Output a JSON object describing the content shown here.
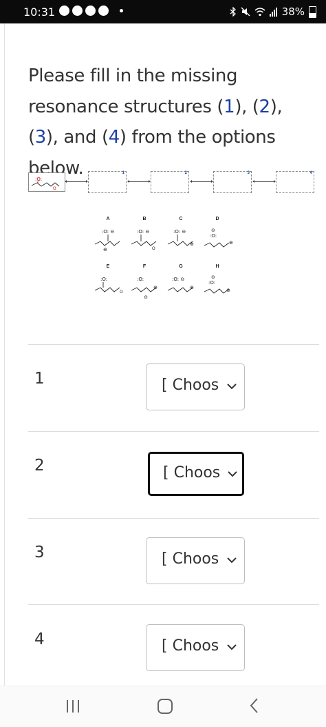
{
  "status_bar": {
    "time": "10:31",
    "battery": "38%"
  },
  "question": {
    "text_before": "Please fill in the missing resonance structures (",
    "n1": "1",
    "sep1": "), (",
    "n2": "2",
    "sep2": "), (",
    "n3": "3",
    "sep3": "), and (",
    "n4": "4",
    "text_after": ") from the options below."
  },
  "scheme": {
    "box_labels": [
      "1",
      "2",
      "3",
      "4"
    ],
    "options": [
      "A",
      "B",
      "C",
      "D",
      "E",
      "F",
      "G",
      "H"
    ]
  },
  "answers": [
    {
      "label": "1",
      "value": "[ Choose ]"
    },
    {
      "label": "2",
      "value": "[ Choose ]"
    },
    {
      "label": "3",
      "value": "[ Choose ]"
    },
    {
      "label": "4",
      "value": "[ Choose ]"
    }
  ],
  "colors": {
    "accent_number": "#1a3fa8",
    "focus_border": "#111111",
    "status_bar_bg": "#0b0b0b"
  },
  "icons": {
    "select_arrow": "chevron-down-icon",
    "nav_recent": "recent-apps-icon",
    "nav_home": "home-icon",
    "nav_back": "back-icon"
  }
}
